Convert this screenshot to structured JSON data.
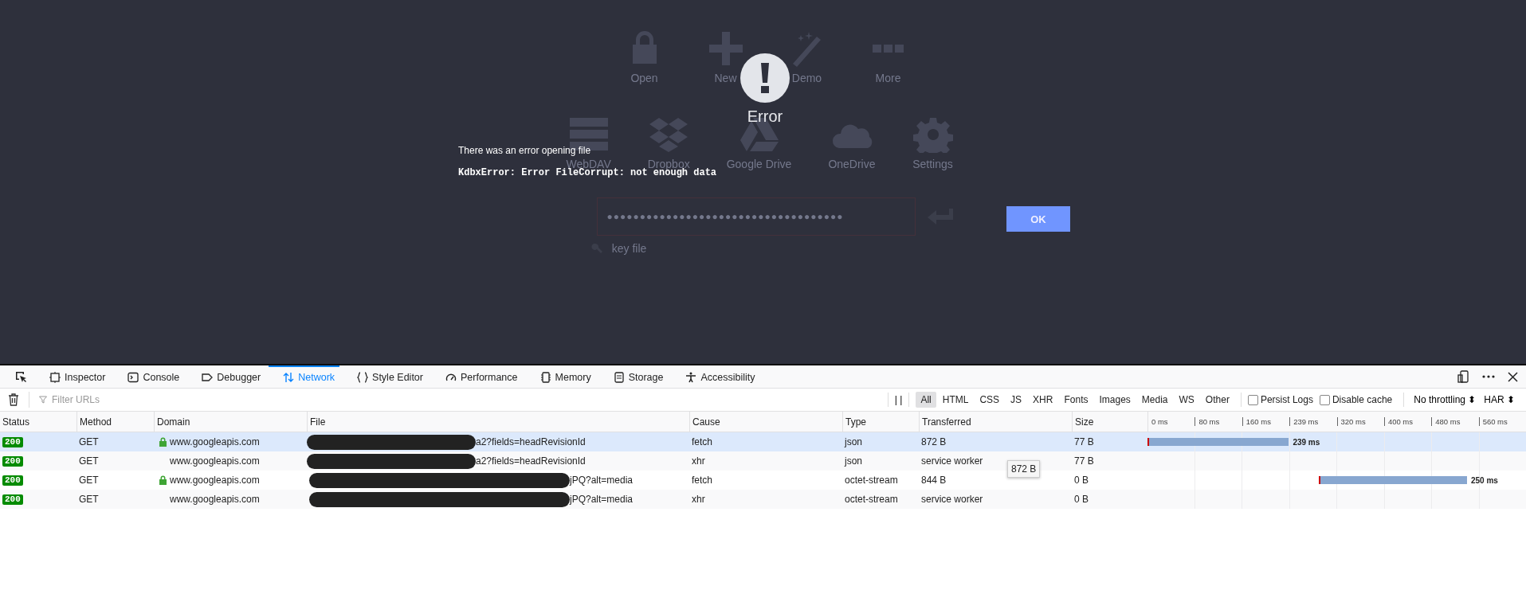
{
  "app": {
    "actions": [
      {
        "label": "Open",
        "kind": "lock"
      },
      {
        "label": "New",
        "kind": "plus"
      },
      {
        "label": "Demo",
        "kind": "wand"
      },
      {
        "label": "More",
        "kind": "dots"
      }
    ],
    "storage": [
      {
        "label": "WebDAV",
        "kind": "server"
      },
      {
        "label": "Dropbox",
        "kind": "box"
      },
      {
        "label": "Google Drive",
        "kind": "drive"
      },
      {
        "label": "OneDrive",
        "kind": "cloud"
      },
      {
        "label": "Settings",
        "kind": "gear"
      }
    ],
    "password": {
      "value": "●●●●●●●●●●●●●●●●●●●●●●●●●●●●●●●●●●●●"
    },
    "key_file": "key file"
  },
  "error_dialog": {
    "title": "Error",
    "message": "There was an error opening file",
    "detail": "KdbxError: Error FileCorrupt: not enough data",
    "button": "OK"
  },
  "devtools": {
    "tabs": [
      {
        "label": "Inspector",
        "kind": "inspector",
        "selected": false
      },
      {
        "label": "Console",
        "kind": "console",
        "selected": false
      },
      {
        "label": "Debugger",
        "kind": "debugger",
        "selected": false
      },
      {
        "label": "Network",
        "kind": "network",
        "selected": true
      },
      {
        "label": "Style Editor",
        "kind": "style",
        "selected": false
      },
      {
        "label": "Performance",
        "kind": "performance",
        "selected": false
      },
      {
        "label": "Memory",
        "kind": "memory",
        "selected": false
      },
      {
        "label": "Storage",
        "kind": "storage",
        "selected": false
      },
      {
        "label": "Accessibility",
        "kind": "accessibility",
        "selected": false
      }
    ],
    "filter": {
      "placeholder": "Filter URLs"
    },
    "pause": "| |",
    "type_filters": [
      {
        "label": "All",
        "selected": true
      },
      {
        "label": "HTML",
        "selected": false
      },
      {
        "label": "CSS",
        "selected": false
      },
      {
        "label": "JS",
        "selected": false
      },
      {
        "label": "XHR",
        "selected": false
      },
      {
        "label": "Fonts",
        "selected": false
      },
      {
        "label": "Images",
        "selected": false
      },
      {
        "label": "Media",
        "selected": false
      },
      {
        "label": "WS",
        "selected": false
      },
      {
        "label": "Other",
        "selected": false
      }
    ],
    "options": [
      {
        "label": "Persist Logs",
        "checked": false
      },
      {
        "label": "Disable cache",
        "checked": false
      }
    ],
    "throttling": "No throttling ⬍",
    "har": "HAR ⬍",
    "columns": [
      "Status",
      "Method",
      "Domain",
      "File",
      "Cause",
      "Type",
      "Transferred",
      "Size"
    ],
    "ticks": [
      "0 ms",
      "80 ms",
      "160 ms",
      "239 ms",
      "320 ms",
      "400 ms",
      "480 ms",
      "560 ms"
    ],
    "rows": [
      {
        "status": "200",
        "method": "GET",
        "secure": true,
        "domain": "www.googleapis.com",
        "file": "a2?fields=headRevisionId",
        "cause": "fetch",
        "type": "json",
        "transferred": "872 B",
        "size": "77 B",
        "selected": true,
        "timing": {
          "label": "239 ms"
        }
      },
      {
        "status": "200",
        "method": "GET",
        "secure": false,
        "domain": "www.googleapis.com",
        "file": "a2?fields=headRevisionId",
        "cause": "xhr",
        "type": "json",
        "transferred": "service worker",
        "size": "77 B",
        "selected": false
      },
      {
        "status": "200",
        "method": "GET",
        "secure": true,
        "domain": "www.googleapis.com",
        "file": "jPQ?alt=media",
        "cause": "fetch",
        "type": "octet-stream",
        "transferred": "844 B",
        "size": "0 B",
        "selected": false,
        "timing": {
          "label": "250 ms"
        }
      },
      {
        "status": "200",
        "method": "GET",
        "secure": false,
        "domain": "www.googleapis.com",
        "file": "jPQ?alt=media",
        "cause": "xhr",
        "type": "octet-stream",
        "transferred": "service worker",
        "size": "0 B",
        "selected": false
      }
    ],
    "tooltip": "872 B"
  }
}
